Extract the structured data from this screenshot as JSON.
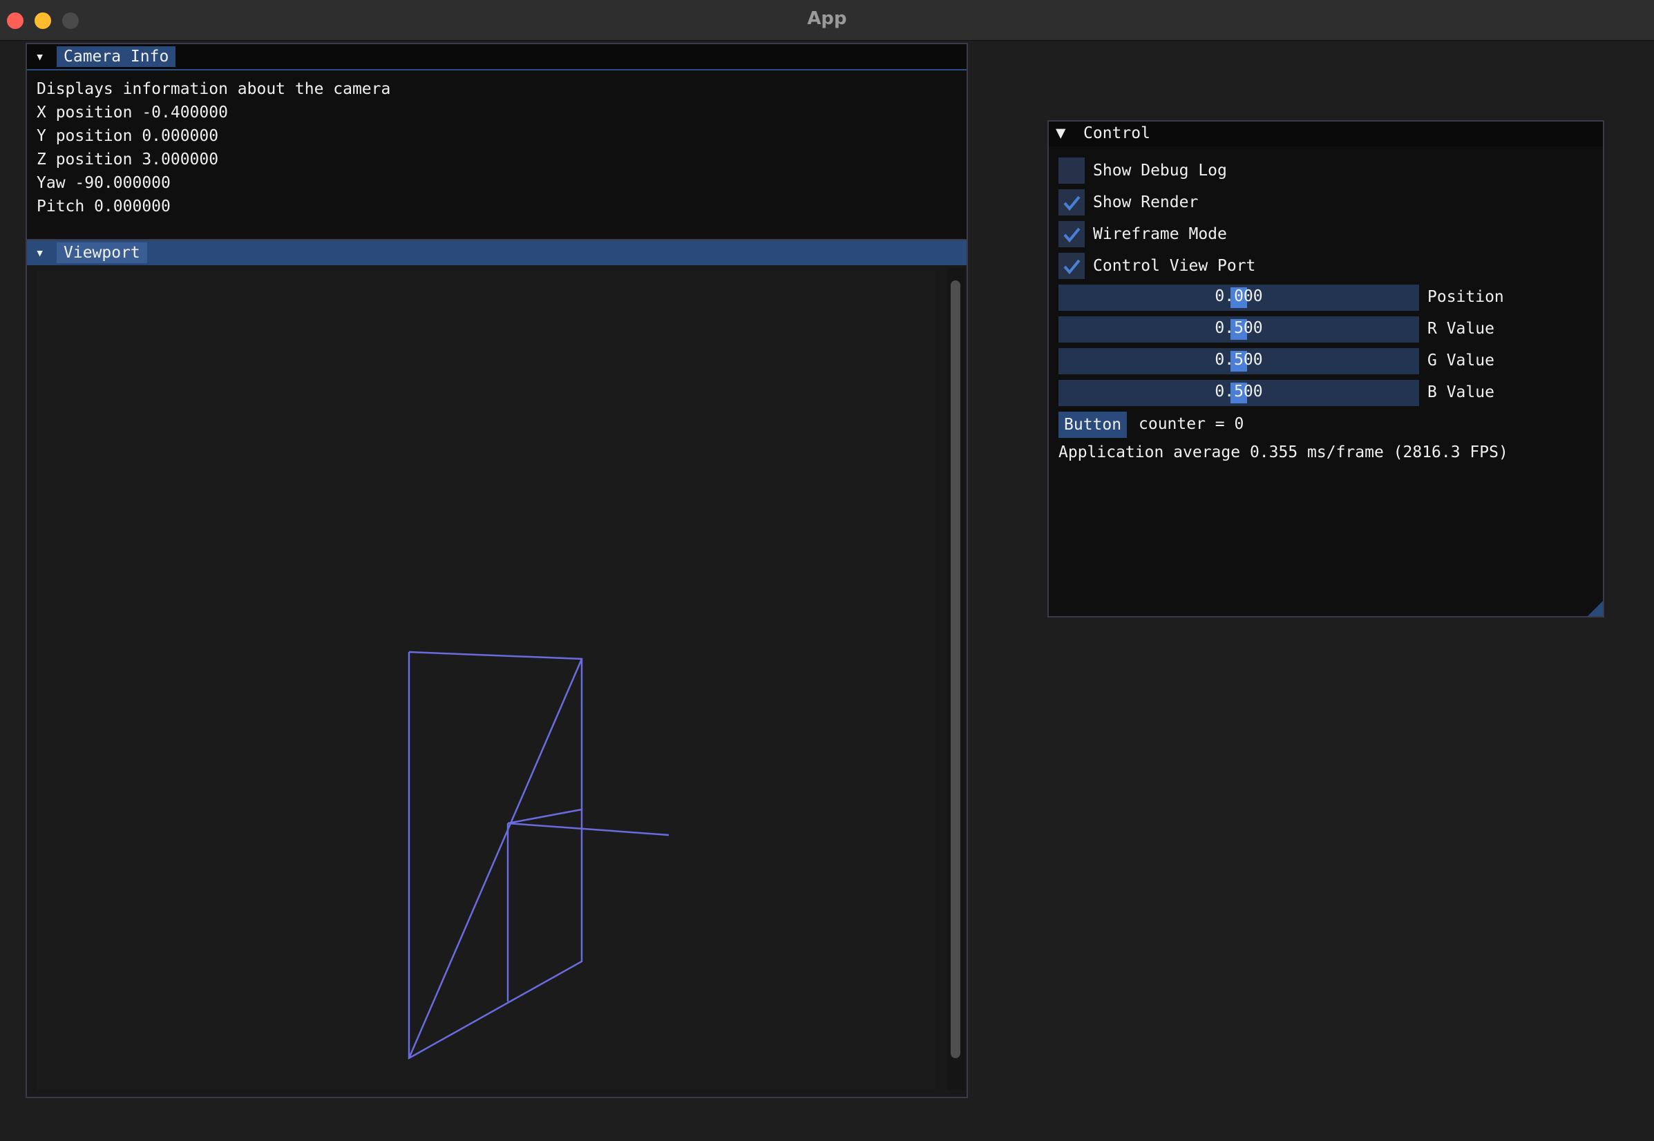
{
  "window": {
    "title": "App"
  },
  "camera_info": {
    "title": "Camera Info",
    "lines": [
      "Displays information about the camera",
      "X position -0.400000",
      "Y position 0.000000",
      "Z position 3.000000",
      "Yaw -90.000000",
      "Pitch 0.000000"
    ]
  },
  "viewport": {
    "title": "Viewport",
    "wire_color": "#6b6be0"
  },
  "control": {
    "title": "Control",
    "checkboxes": [
      {
        "label": "Show Debug Log",
        "checked": false
      },
      {
        "label": "Show Render",
        "checked": true
      },
      {
        "label": "Wireframe Mode",
        "checked": true
      },
      {
        "label": "Control View Port",
        "checked": true
      }
    ],
    "sliders": [
      {
        "value": "0.000",
        "label": "Position"
      },
      {
        "value": "0.500",
        "label": "R Value"
      },
      {
        "value": "0.500",
        "label": "G Value"
      },
      {
        "value": "0.500",
        "label": "B Value"
      }
    ],
    "button_label": "Button",
    "counter_text": "counter = 0",
    "fps_text": "Application average 0.355 ms/frame (2816.3 FPS)"
  },
  "colors": {
    "accent": "#294a7a",
    "check": "#4b7fd6",
    "frame_bg": "#233450"
  }
}
